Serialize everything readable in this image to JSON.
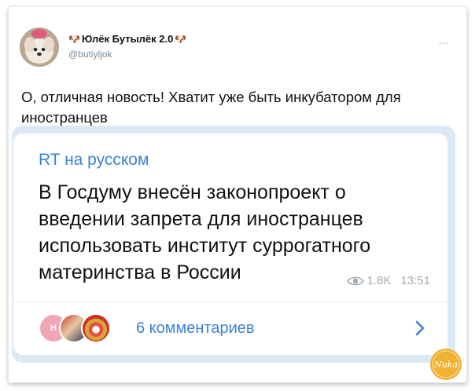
{
  "author": {
    "display_name": "Юлёк Бутылёк 2.0",
    "handle": "@butiyljok",
    "more": "..."
  },
  "tweet": {
    "text": "О, отличная новость! Хватит уже быть инкубатором для иностранцев"
  },
  "embed": {
    "channel": "RT на русском",
    "headline": "В Госдуму внесён законопроект о введении запрета для иностранцев использовать институт суррогатного материнства в России",
    "views": "1.8K",
    "time": "13:51",
    "avatar_letter": "Н",
    "comments_label": "6 комментариев"
  },
  "watermark": {
    "text": "Nuka"
  },
  "colors": {
    "accent": "#3b82d6",
    "embed_border": "#dbe8f5",
    "meta": "#a4adb7",
    "watermark": "#f0b233"
  }
}
